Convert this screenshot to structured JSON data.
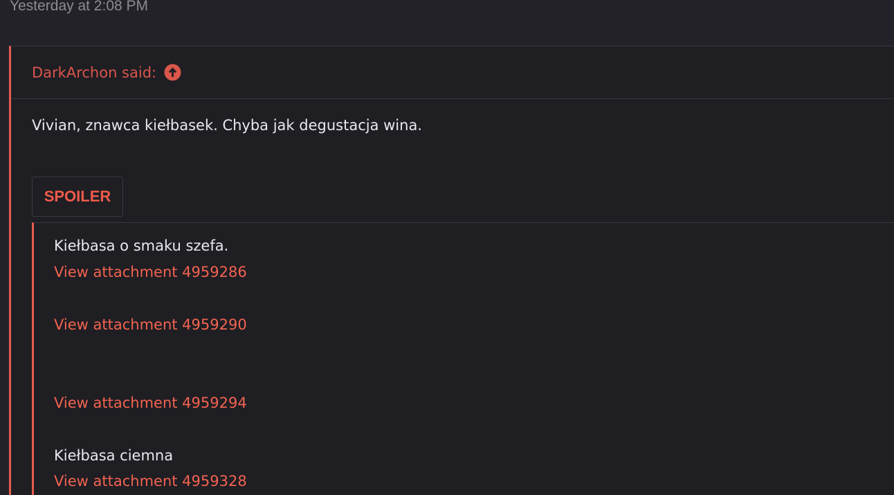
{
  "post": {
    "timestamp": "Yesterday at 2:08 PM"
  },
  "quote": {
    "author_label": "DarkArchon said:",
    "jump_icon": "arrow-circle-up-icon",
    "text": "Vivian, znawca kiełbasek. Chyba jak degustacja wina."
  },
  "spoiler": {
    "button_label": "SPOILER",
    "items": [
      {
        "type": "text",
        "value": "Kiełbasa o smaku szefa."
      },
      {
        "type": "link",
        "value": "View attachment 4959286"
      },
      {
        "type": "link",
        "value": "View attachment 4959290"
      },
      {
        "type": "link",
        "value": "View attachment 4959294"
      },
      {
        "type": "text",
        "value": "Kiełbasa ciemna"
      },
      {
        "type": "link",
        "value": "View attachment 4959328"
      }
    ]
  },
  "colors": {
    "background": "#232228",
    "accent": "#e65c4f",
    "text": "#e9e8ee",
    "muted": "#8c8b92"
  }
}
